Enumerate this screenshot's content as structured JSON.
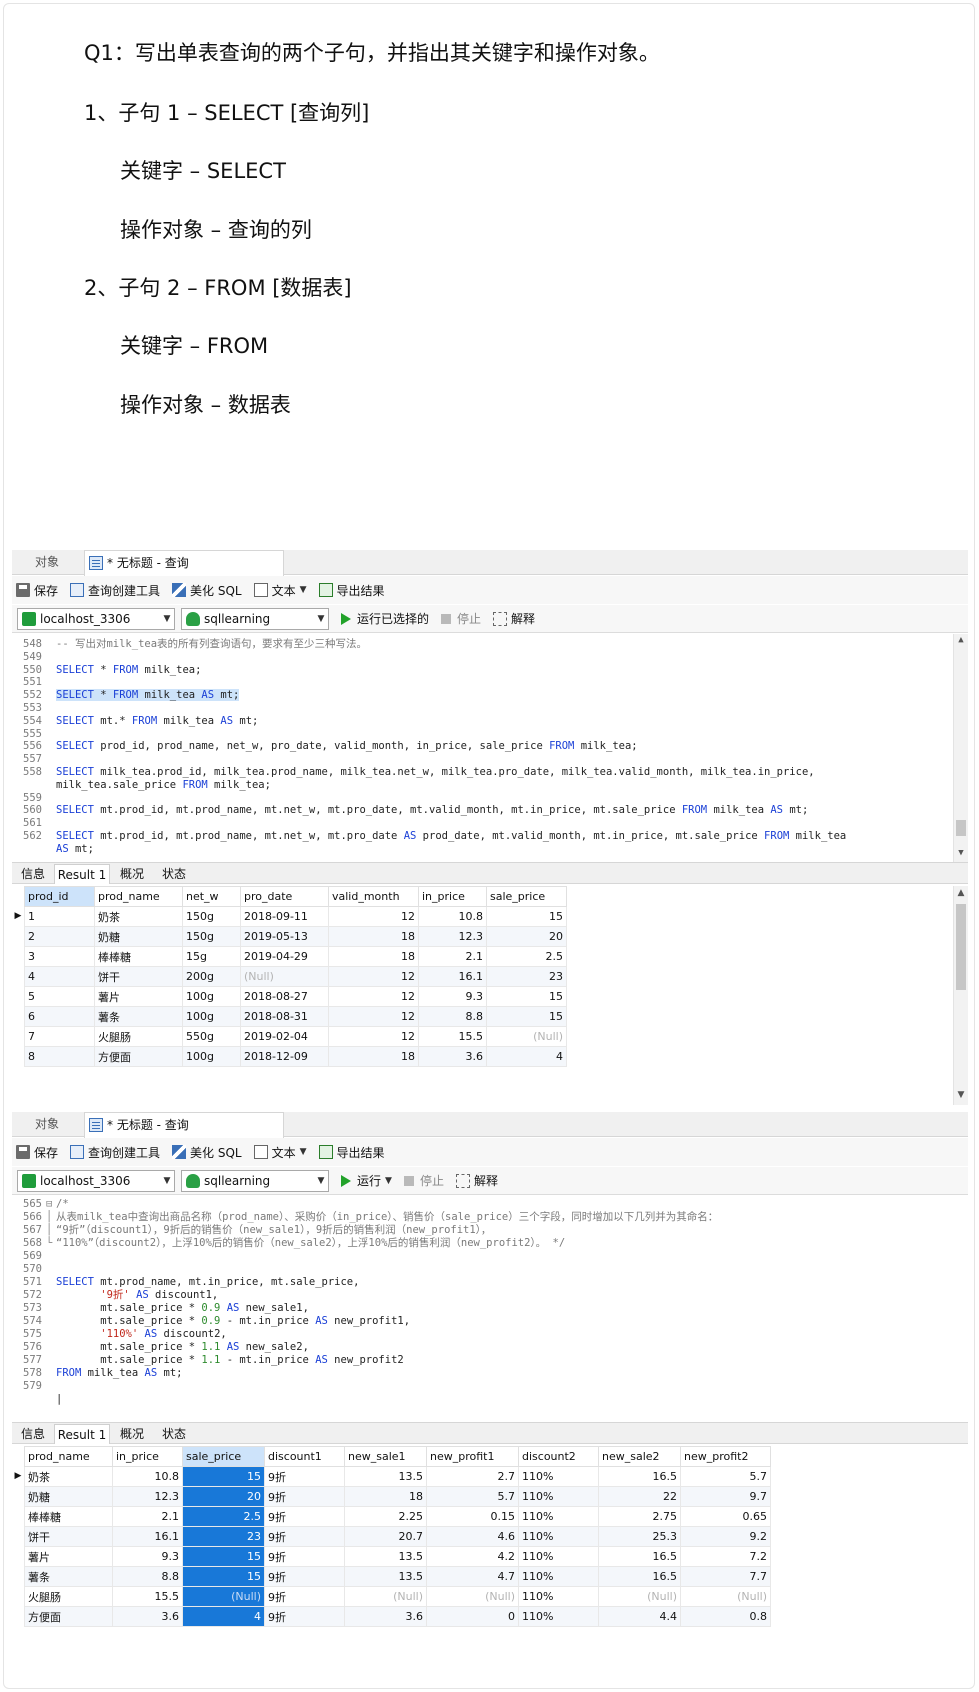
{
  "qa": {
    "question": "Q1：写出单表查询的两个子句，并指出其关键字和操作对象。",
    "clause1": "1、子句 1 – SELECT [查询列]",
    "clause1_keyword": "关键字 – SELECT",
    "clause1_object": "操作对象 – 查询的列",
    "clause2": "2、子句 2 – FROM [数据表]",
    "clause2_keyword": "关键字 – FROM",
    "clause2_object": "操作对象 – 数据表"
  },
  "panel1": {
    "tab_object": "对象",
    "tab_query": "* 无标题 - 查询",
    "toolbar": {
      "save": "保存",
      "query_builder": "查询创建工具",
      "beautify": "美化 SQL",
      "text": "文本",
      "export": "导出结果"
    },
    "connection": "localhost_3306",
    "database": "sqllearning",
    "run": "运行已选择的",
    "stop": "停止",
    "explain": "解释",
    "result_tabs": [
      "信息",
      "Result 1",
      "概况",
      "状态"
    ],
    "columns": [
      "prod_id",
      "prod_name",
      "net_w",
      "pro_date",
      "valid_month",
      "in_price",
      "sale_price"
    ],
    "rows": [
      [
        "1",
        "奶茶",
        "150g",
        "2018-09-11",
        "12",
        "10.8",
        "15"
      ],
      [
        "2",
        "奶糖",
        "150g",
        "2019-05-13",
        "18",
        "12.3",
        "20"
      ],
      [
        "3",
        "棒棒糖",
        "15g",
        "2019-04-29",
        "18",
        "2.1",
        "2.5"
      ],
      [
        "4",
        "饼干",
        "200g",
        "(Null)",
        "12",
        "16.1",
        "23"
      ],
      [
        "5",
        "薯片",
        "100g",
        "2018-08-27",
        "12",
        "9.3",
        "15"
      ],
      [
        "6",
        "薯条",
        "100g",
        "2018-08-31",
        "12",
        "8.8",
        "15"
      ],
      [
        "7",
        "火腿肠",
        "550g",
        "2019-02-04",
        "12",
        "15.5",
        "(Null)"
      ],
      [
        "8",
        "方便面",
        "100g",
        "2018-12-09",
        "18",
        "3.6",
        "4"
      ]
    ]
  },
  "panel2": {
    "tab_object": "对象",
    "tab_query": "* 无标题 - 查询",
    "toolbar": {
      "save": "保存",
      "query_builder": "查询创建工具",
      "beautify": "美化 SQL",
      "text": "文本",
      "export": "导出结果"
    },
    "connection": "localhost_3306",
    "database": "sqllearning",
    "run": "运行",
    "stop": "停止",
    "explain": "解释",
    "result_tabs": [
      "信息",
      "Result 1",
      "概况",
      "状态"
    ],
    "columns": [
      "prod_name",
      "in_price",
      "sale_price",
      "discount1",
      "new_sale1",
      "new_profit1",
      "discount2",
      "new_sale2",
      "new_profit2"
    ],
    "rows": [
      [
        "奶茶",
        "10.8",
        "15",
        "9折",
        "13.5",
        "2.7",
        "110%",
        "16.5",
        "5.7"
      ],
      [
        "奶糖",
        "12.3",
        "20",
        "9折",
        "18",
        "5.7",
        "110%",
        "22",
        "9.7"
      ],
      [
        "棒棒糖",
        "2.1",
        "2.5",
        "9折",
        "2.25",
        "0.15",
        "110%",
        "2.75",
        "0.65"
      ],
      [
        "饼干",
        "16.1",
        "23",
        "9折",
        "20.7",
        "4.6",
        "110%",
        "25.3",
        "9.2"
      ],
      [
        "薯片",
        "9.3",
        "15",
        "9折",
        "13.5",
        "4.2",
        "110%",
        "16.5",
        "7.2"
      ],
      [
        "薯条",
        "8.8",
        "15",
        "9折",
        "13.5",
        "4.7",
        "110%",
        "16.5",
        "7.7"
      ],
      [
        "火腿肠",
        "15.5",
        "(Null)",
        "9折",
        "(Null)",
        "(Null)",
        "110%",
        "(Null)",
        "(Null)"
      ],
      [
        "方便面",
        "3.6",
        "4",
        "9折",
        "3.6",
        "0",
        "110%",
        "4.4",
        "0.8"
      ]
    ]
  },
  "editor1": [
    {
      "ln": "548",
      "segs": [
        [
          "cm",
          "-- 写出对milk_tea表的所有列查询语句，要求有至少三种写法。"
        ]
      ]
    },
    {
      "ln": "549",
      "segs": []
    },
    {
      "ln": "550",
      "segs": [
        [
          "kw",
          "SELECT"
        ],
        [
          "plain",
          " * "
        ],
        [
          "kw",
          "FROM"
        ],
        [
          "plain",
          " milk_tea;"
        ]
      ]
    },
    {
      "ln": "551",
      "segs": []
    },
    {
      "ln": "552",
      "hl": true,
      "segs": [
        [
          "kw",
          "SELECT"
        ],
        [
          "plain",
          " * "
        ],
        [
          "kw",
          "FROM"
        ],
        [
          "plain",
          " milk_tea "
        ],
        [
          "kw",
          "AS"
        ],
        [
          "plain",
          " mt;"
        ]
      ]
    },
    {
      "ln": "553",
      "segs": []
    },
    {
      "ln": "554",
      "segs": [
        [
          "kw",
          "SELECT"
        ],
        [
          "plain",
          " mt.* "
        ],
        [
          "kw",
          "FROM"
        ],
        [
          "plain",
          " milk_tea "
        ],
        [
          "kw",
          "AS"
        ],
        [
          "plain",
          " mt;"
        ]
      ]
    },
    {
      "ln": "555",
      "segs": []
    },
    {
      "ln": "556",
      "segs": [
        [
          "kw",
          "SELECT"
        ],
        [
          "plain",
          " prod_id, prod_name, net_w, pro_date, valid_month, in_price, sale_price "
        ],
        [
          "kw",
          "FROM"
        ],
        [
          "plain",
          " milk_tea;"
        ]
      ]
    },
    {
      "ln": "557",
      "segs": []
    },
    {
      "ln": "558",
      "segs": [
        [
          "kw",
          "SELECT"
        ],
        [
          "plain",
          " milk_tea.prod_id, milk_tea.prod_name, milk_tea.net_w, milk_tea.pro_date, milk_tea.valid_month, milk_tea.in_price,"
        ]
      ]
    },
    {
      "ln": "",
      "segs": [
        [
          "plain",
          "milk_tea.sale_price "
        ],
        [
          "kw",
          "FROM"
        ],
        [
          "plain",
          " milk_tea;"
        ]
      ]
    },
    {
      "ln": "559",
      "segs": []
    },
    {
      "ln": "560",
      "segs": [
        [
          "kw",
          "SELECT"
        ],
        [
          "plain",
          " mt.prod_id, mt.prod_name, mt.net_w, mt.pro_date, mt.valid_month, mt.in_price, mt.sale_price "
        ],
        [
          "kw",
          "FROM"
        ],
        [
          "plain",
          " milk_tea "
        ],
        [
          "kw",
          "AS"
        ],
        [
          "plain",
          " mt;"
        ]
      ]
    },
    {
      "ln": "561",
      "segs": []
    },
    {
      "ln": "562",
      "segs": [
        [
          "kw",
          "SELECT"
        ],
        [
          "plain",
          " mt.prod_id, mt.prod_name, mt.net_w, mt.pro_date "
        ],
        [
          "kw",
          "AS"
        ],
        [
          "plain",
          " prod_date, mt.valid_month, mt.in_price, mt.sale_price "
        ],
        [
          "kw",
          "FROM"
        ],
        [
          "plain",
          " milk_tea"
        ]
      ]
    },
    {
      "ln": "",
      "segs": [
        [
          "kw",
          "AS"
        ],
        [
          "plain",
          " mt;"
        ]
      ]
    }
  ],
  "editor2": [
    {
      "ln": "565",
      "fold": "⊟",
      "segs": [
        [
          "cm",
          "/*"
        ]
      ]
    },
    {
      "ln": "566",
      "fold": "│",
      "segs": [
        [
          "cm",
          "从表milk_tea中查询出商品名称（prod_name）、采购价（in_price）、销售价（sale_price）三个字段，同时增加以下几列并为其命名："
        ]
      ]
    },
    {
      "ln": "567",
      "fold": "│",
      "segs": [
        [
          "cm",
          "“9折”（discount1），9折后的销售价（new_sale1），9折后的销售利润（new_profit1），"
        ]
      ]
    },
    {
      "ln": "568",
      "fold": "└",
      "segs": [
        [
          "cm",
          "“110%”（discount2），上浮10%后的销售价（new_sale2），上浮10%后的销售利润（new_profit2）。 */"
        ]
      ]
    },
    {
      "ln": "569",
      "segs": []
    },
    {
      "ln": "570",
      "segs": []
    },
    {
      "ln": "571",
      "segs": [
        [
          "kw",
          "SELECT"
        ],
        [
          "plain",
          " mt.prod_name, mt.in_price, mt.sale_price,"
        ]
      ]
    },
    {
      "ln": "572",
      "segs": [
        [
          "plain",
          "       "
        ],
        [
          "str",
          "'9折'"
        ],
        [
          "plain",
          " "
        ],
        [
          "kw",
          "AS"
        ],
        [
          "plain",
          " discount1,"
        ]
      ]
    },
    {
      "ln": "573",
      "segs": [
        [
          "plain",
          "       mt.sale_price * "
        ],
        [
          "num",
          "0.9"
        ],
        [
          "plain",
          " "
        ],
        [
          "kw",
          "AS"
        ],
        [
          "plain",
          " new_sale1,"
        ]
      ]
    },
    {
      "ln": "574",
      "segs": [
        [
          "plain",
          "       mt.sale_price * "
        ],
        [
          "num",
          "0.9"
        ],
        [
          "plain",
          " - mt.in_price "
        ],
        [
          "kw",
          "AS"
        ],
        [
          "plain",
          " new_profit1,"
        ]
      ]
    },
    {
      "ln": "575",
      "segs": [
        [
          "plain",
          "       "
        ],
        [
          "str",
          "'110%'"
        ],
        [
          "plain",
          " "
        ],
        [
          "kw",
          "AS"
        ],
        [
          "plain",
          " discount2,"
        ]
      ]
    },
    {
      "ln": "576",
      "segs": [
        [
          "plain",
          "       mt.sale_price * "
        ],
        [
          "num",
          "1.1"
        ],
        [
          "plain",
          " "
        ],
        [
          "kw",
          "AS"
        ],
        [
          "plain",
          " new_sale2,"
        ]
      ]
    },
    {
      "ln": "577",
      "segs": [
        [
          "plain",
          "       mt.sale_price * "
        ],
        [
          "num",
          "1.1"
        ],
        [
          "plain",
          " - mt.in_price "
        ],
        [
          "kw",
          "AS"
        ],
        [
          "plain",
          " new_profit2"
        ]
      ]
    },
    {
      "ln": "578",
      "segs": [
        [
          "kw",
          "FROM"
        ],
        [
          "plain",
          " milk_tea "
        ],
        [
          "kw",
          "AS"
        ],
        [
          "plain",
          " mt;"
        ]
      ]
    },
    {
      "ln": "579",
      "segs": []
    },
    {
      "ln": "",
      "segs": [
        [
          "plain",
          "|"
        ]
      ]
    }
  ]
}
